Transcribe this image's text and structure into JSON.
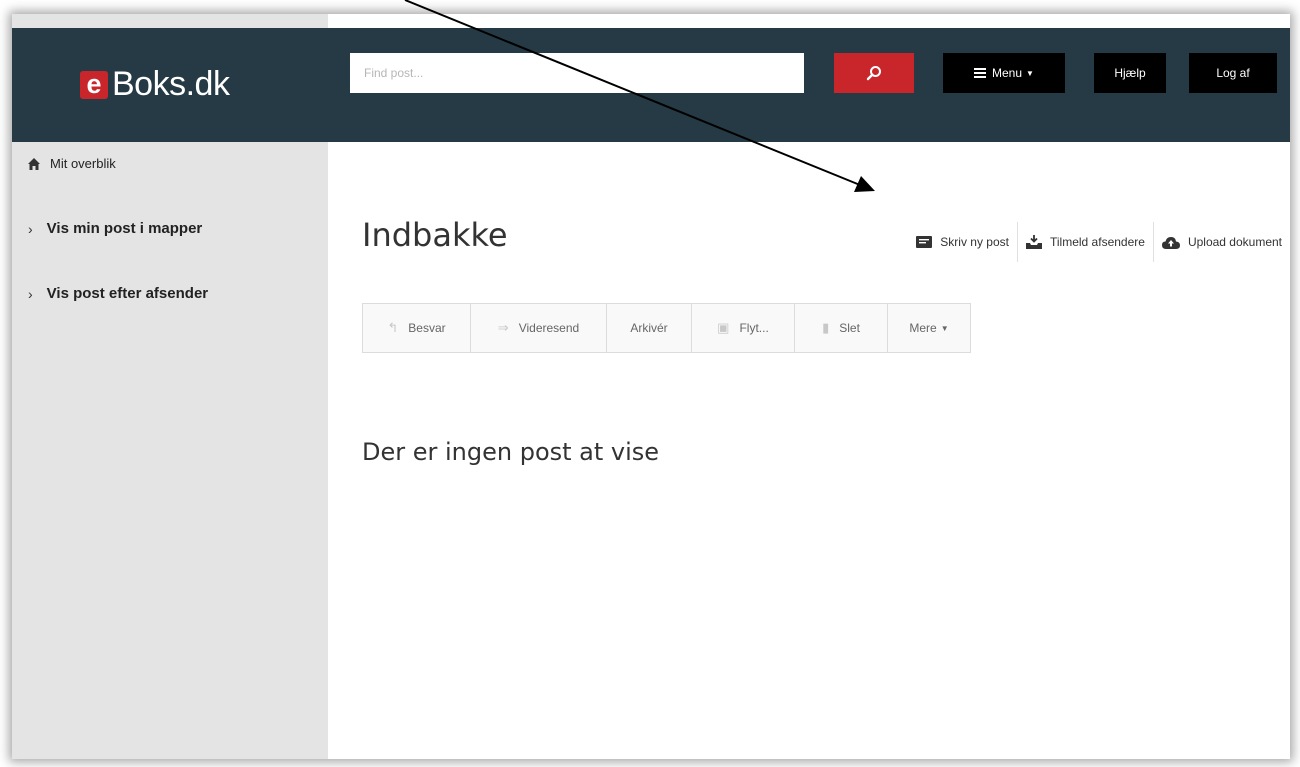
{
  "brand": {
    "logo_letter": "e",
    "logo_name": "Boks.dk"
  },
  "search": {
    "placeholder": "Find post..."
  },
  "nav": {
    "menu": "Menu",
    "help": "Hjælp",
    "logout": "Log af"
  },
  "sidebar": {
    "home": "Mit overblik",
    "items": [
      {
        "label": "Vis min post i mapper"
      },
      {
        "label": "Vis post efter afsender"
      }
    ]
  },
  "main": {
    "title": "Indbakke",
    "actions": [
      {
        "label": "Skriv ny post",
        "icon": "compose-icon"
      },
      {
        "label": "Tilmeld afsendere",
        "icon": "inbox-download-icon"
      },
      {
        "label": "Upload dokument",
        "icon": "cloud-upload-icon"
      }
    ],
    "toolbar": {
      "reply": "Besvar",
      "forward": "Videresend",
      "archive": "Arkivér",
      "move": "Flyt...",
      "delete": "Slet",
      "more": "Mere"
    },
    "empty_message": "Der er ingen post at vise"
  },
  "colors": {
    "header_bg": "#253a45",
    "brand_red": "#c9262c",
    "sidebar_bg": "#e4e4e4"
  }
}
